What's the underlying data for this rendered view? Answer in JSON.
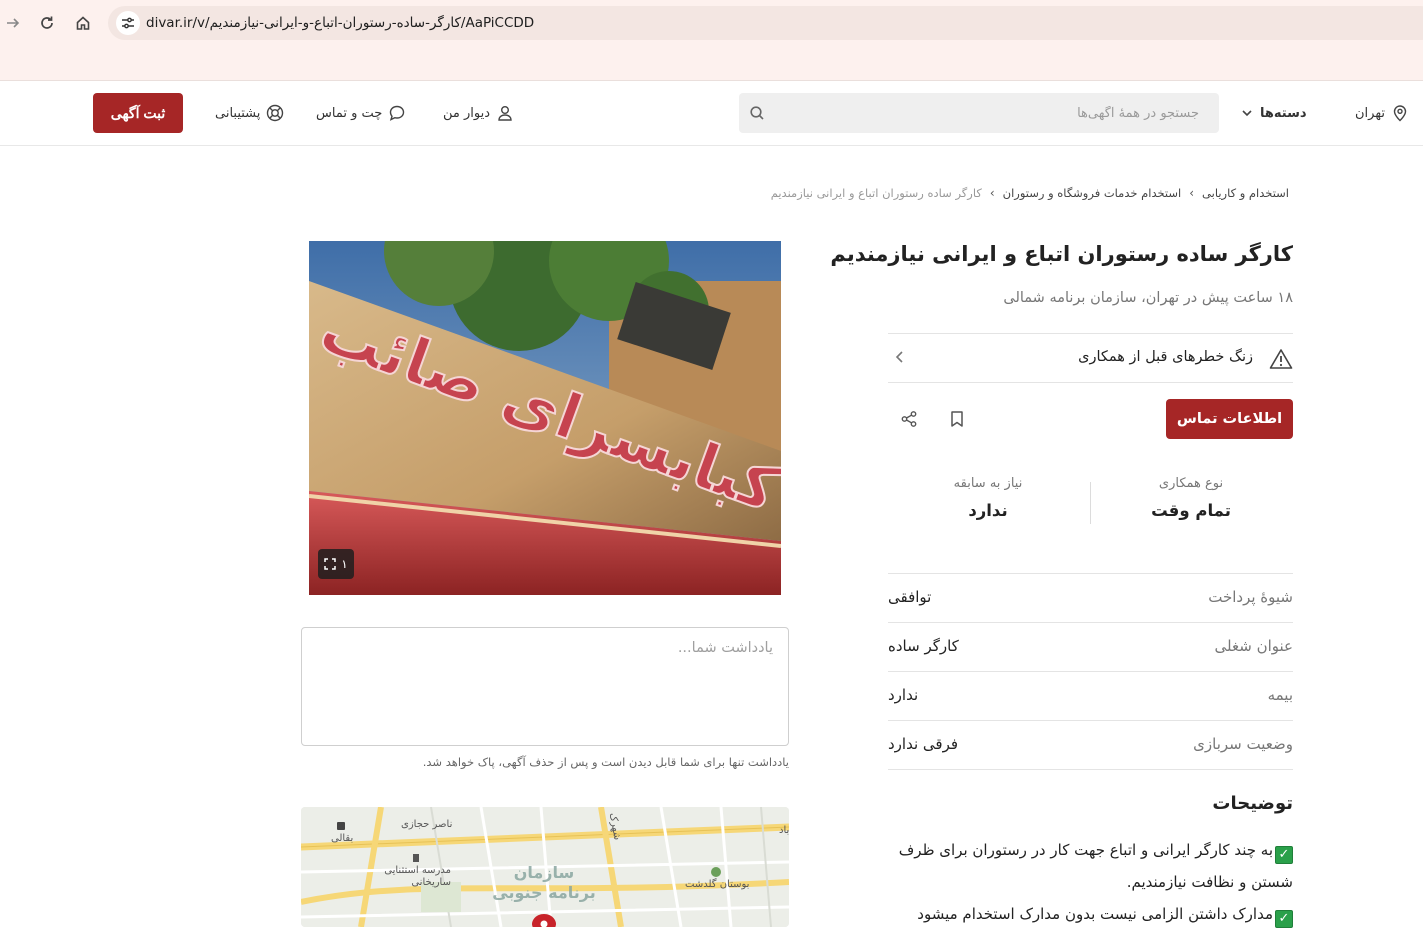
{
  "browser": {
    "url_host": "divar.ir/v/",
    "url_path": "کارگر-ساده-رستوران-اتباع-و-ایرانی-نیازمندیم/AaPiCCDD"
  },
  "header": {
    "city": "تهران",
    "categories": "دسته‌ها",
    "search_placeholder": "جستجو در همهٔ آگهی‌ها",
    "my_divar": "دیوار من",
    "chat": "چت و تماس",
    "support": "پشتیبانی",
    "post_ad": "ثبت آگهی"
  },
  "breadcrumb": [
    "استخدام و کاریابی",
    "استخدام خدمات فروشگاه و رستوران",
    "کارگر ساده رستوران اتباع و ایرانی نیازمندیم"
  ],
  "ad": {
    "title": "کارگر ساده رستوران اتباع و ایرانی نیازمندیم",
    "subtitle": "۱۸ ساعت پیش در تهران، سازمان برنامه شمالی",
    "warning": "زنگ خطرهای قبل از همکاری",
    "contact_button": "اطلاعات تماس",
    "stats": [
      {
        "label": "نوع همکاری",
        "value": "تمام وقت"
      },
      {
        "label": "نیاز به سابقه",
        "value": "ندارد"
      }
    ],
    "attributes": [
      {
        "key": "شیوهٔ پرداخت",
        "value": "توافقی"
      },
      {
        "key": "عنوان شغلی",
        "value": "کارگر ساده"
      },
      {
        "key": "بیمه",
        "value": "ندارد"
      },
      {
        "key": "وضعیت سربازی",
        "value": "فرقی ندارد"
      }
    ],
    "description_title": "توضیحات",
    "description_lines": [
      "به چند کارگر ایرانی و اتباع جهت کار در رستوران برای ظرف شستن و نظافت نیازمندیم.",
      "مدارک داشتن الزامی نیست بدون مدارک استخدام میشود"
    ]
  },
  "photo": {
    "count": "۱",
    "sign_text": "کبابسرای صائب"
  },
  "note": {
    "placeholder": "یادداشت شما...",
    "hint": "یادداشت تنها برای شما قابل دیدن است و پس از حذف آگهی، پاک خواهد شد."
  },
  "map": {
    "labels": [
      "ناصر حجازی",
      "بقالی",
      "مدرسه استثنایی ساریخانی",
      "بوستان گلدشت",
      "شهرک",
      "باد"
    ],
    "area_label": "سازمان برنامه جنوبی"
  },
  "colors": {
    "brand": "#a62626",
    "check": "#2aa04a"
  }
}
